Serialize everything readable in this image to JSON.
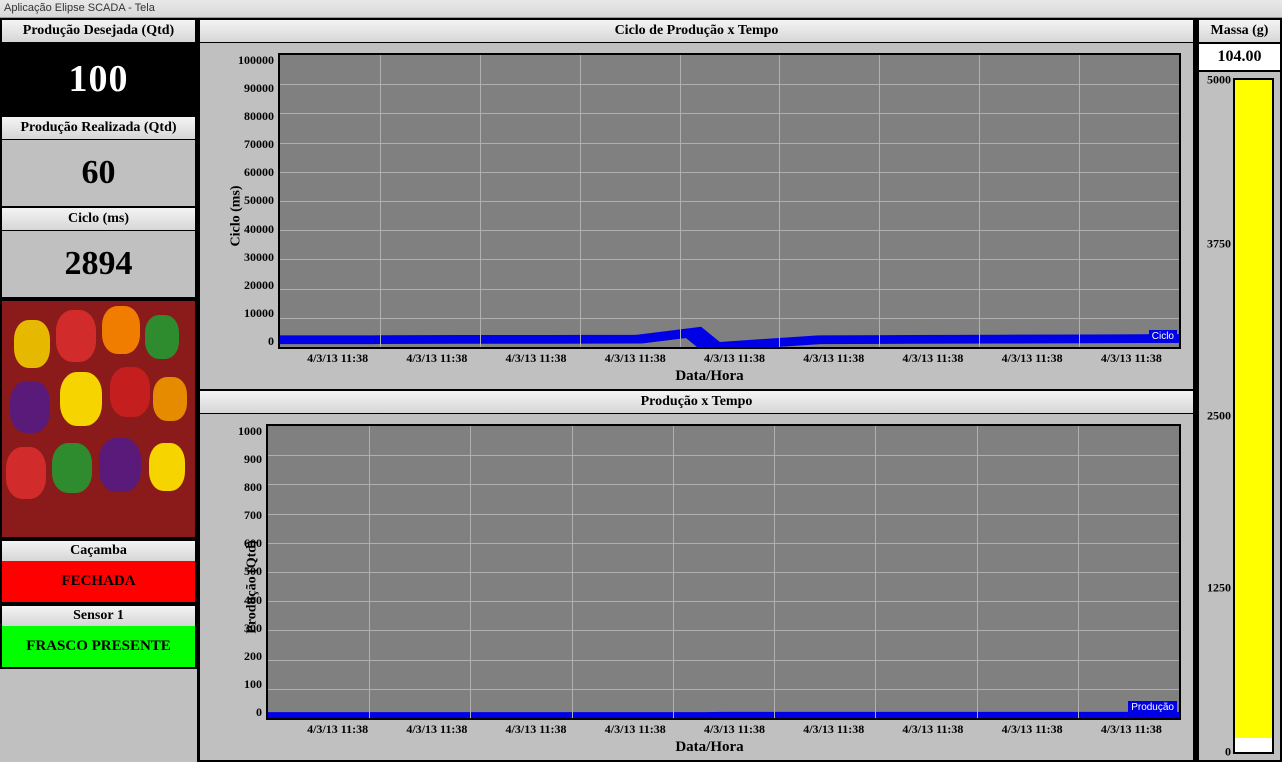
{
  "window": {
    "title": "Aplicação Elipse SCADA - Tela"
  },
  "left": {
    "prod_desejada": {
      "label": "Produção Desejada (Qtd)",
      "value": "100"
    },
    "prod_realizada": {
      "label": "Produção Realizada (Qtd)",
      "value": "60"
    },
    "ciclo": {
      "label": "Ciclo (ms)",
      "value": "2894"
    },
    "cacamba": {
      "label": "Caçamba",
      "status": "FECHADA"
    },
    "sensor1": {
      "label": "Sensor 1",
      "status": "FRASCO PRESENTE"
    }
  },
  "mass": {
    "label": "Massa (g)",
    "value": "104.00",
    "max": 5000,
    "ticks": [
      "5000",
      "3750",
      "2500",
      "1250",
      "0"
    ],
    "fill_pct": 97.9
  },
  "chart_data": [
    {
      "type": "line",
      "title": "Ciclo de Produção x Tempo",
      "xlabel": "Data/Hora",
      "ylabel": "Ciclo (ms)",
      "ylim": [
        0,
        100000
      ],
      "y_ticks": [
        "100000",
        "90000",
        "80000",
        "70000",
        "60000",
        "50000",
        "40000",
        "30000",
        "20000",
        "10000",
        "0"
      ],
      "x_ticks": [
        "4/3/13 11:38",
        "4/3/13 11:38",
        "4/3/13 11:38",
        "4/3/13 11:38",
        "4/3/13 11:38",
        "4/3/13 11:38",
        "4/3/13 11:38",
        "4/3/13 11:38",
        "4/3/13 11:38"
      ],
      "series": [
        {
          "name": "Ciclo",
          "values": [
            2500,
            2500,
            2600,
            2600,
            2700,
            5000,
            0,
            2500,
            2600,
            2700,
            2800,
            2900,
            2900,
            2900
          ]
        }
      ],
      "legend": "Ciclo"
    },
    {
      "type": "line",
      "title": "Produção x Tempo",
      "xlabel": "Data/Hora",
      "ylabel": "Produção (Qtd)",
      "ylim": [
        0,
        1000
      ],
      "y_ticks": [
        "1000",
        "900",
        "800",
        "700",
        "600",
        "500",
        "400",
        "300",
        "200",
        "100",
        "0"
      ],
      "x_ticks": [
        "4/3/13 11:38",
        "4/3/13 11:38",
        "4/3/13 11:38",
        "4/3/13 11:38",
        "4/3/13 11:38",
        "4/3/13 11:38",
        "4/3/13 11:38",
        "4/3/13 11:38",
        "4/3/13 11:38"
      ],
      "series": [
        {
          "name": "Produção",
          "values": [
            5,
            5,
            5,
            5,
            5,
            5,
            5,
            6,
            6,
            6,
            6,
            6,
            6,
            6
          ]
        }
      ],
      "legend": "Produção"
    }
  ]
}
